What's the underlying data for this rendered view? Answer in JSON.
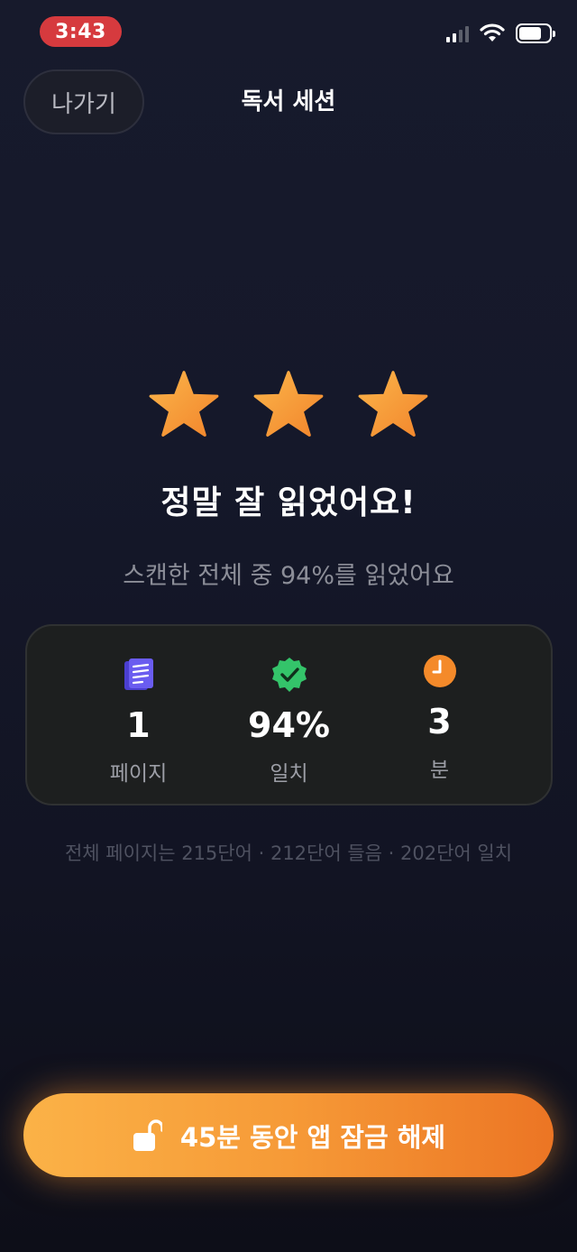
{
  "status_bar": {
    "time": "3:43"
  },
  "header": {
    "exit_label": "나가기",
    "title": "독서 세션"
  },
  "result": {
    "star_count": 3,
    "headline": "정말 잘 읽었어요!",
    "subline": "스캔한 전체 중 94%를 읽었어요"
  },
  "stats": [
    {
      "icon": "document-icon",
      "value": "1",
      "label": "페이지"
    },
    {
      "icon": "verified-badge-icon",
      "value": "94%",
      "label": "일치"
    },
    {
      "icon": "clock-icon",
      "value": "3",
      "label": "분"
    }
  ],
  "footnote": "전체 페이지는 215단어 · 212단어 들음 · 202단어 일치",
  "unlock_button": {
    "label": "45분 동안 앱 잠금 해제",
    "icon": "unlock-icon"
  },
  "colors": {
    "accent_orange": "#f69a37",
    "star": "#f7a23a",
    "document_icon": "#6a5cf0",
    "badge_icon": "#34c46a",
    "clock_icon": "#f48a2a",
    "status_time_bg": "#d63a3e"
  }
}
